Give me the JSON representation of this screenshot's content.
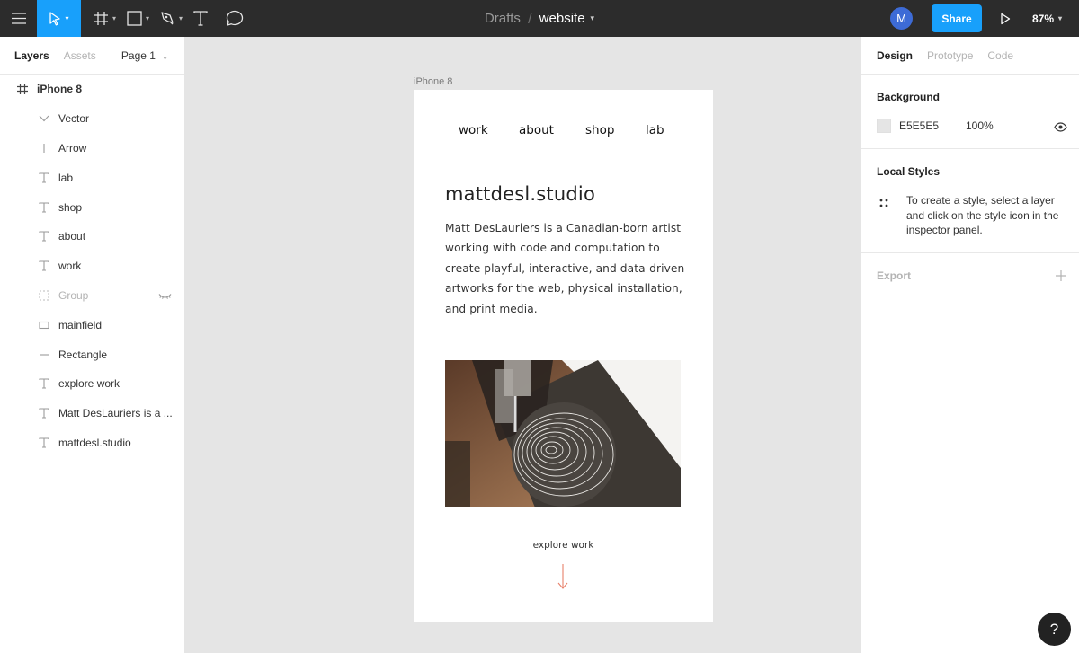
{
  "toolbar": {
    "breadcrumb_drafts": "Drafts",
    "breadcrumb_sep": "/",
    "file_name": "website",
    "avatar_initial": "M",
    "share_label": "Share",
    "zoom": "87%"
  },
  "left_panel": {
    "tabs": [
      "Layers",
      "Assets"
    ],
    "page": "Page 1",
    "frame": {
      "name": "iPhone 8",
      "icon": "frame-icon"
    },
    "layers": [
      {
        "name": "Vector",
        "icon": "vector-icon"
      },
      {
        "name": "Arrow",
        "icon": "line-icon"
      },
      {
        "name": "lab",
        "icon": "text-icon"
      },
      {
        "name": "shop",
        "icon": "text-icon"
      },
      {
        "name": "about",
        "icon": "text-icon"
      },
      {
        "name": "work",
        "icon": "text-icon"
      },
      {
        "name": "Group",
        "icon": "group-icon",
        "hidden": true
      },
      {
        "name": "mainfield",
        "icon": "rectangle-icon"
      },
      {
        "name": "Rectangle",
        "icon": "line-icon"
      },
      {
        "name": "explore work",
        "icon": "text-icon"
      },
      {
        "name": "Matt DesLauriers is a ...",
        "icon": "text-icon"
      },
      {
        "name": "mattdesl.studio",
        "icon": "text-icon"
      }
    ]
  },
  "canvas": {
    "frame_label": "iPhone 8",
    "nav": [
      "work",
      "about",
      "shop",
      "lab"
    ],
    "site_title": "mattdesl.studio",
    "bio": "Matt DesLauriers is a Canadian-born artist working with code and computation to create playful, interactive, and data-driven artworks for the web, physical installation, and print media.",
    "explore": "explore work",
    "accent_color": "#e8806a"
  },
  "right_panel": {
    "tabs": [
      "Design",
      "Prototype",
      "Code"
    ],
    "background_title": "Background",
    "background_hex": "E5E5E5",
    "background_opacity": "100%",
    "local_styles_title": "Local Styles",
    "local_styles_hint": "To create a style, select a layer and click on the style icon in the inspector panel.",
    "export_title": "Export"
  },
  "help_label": "?"
}
